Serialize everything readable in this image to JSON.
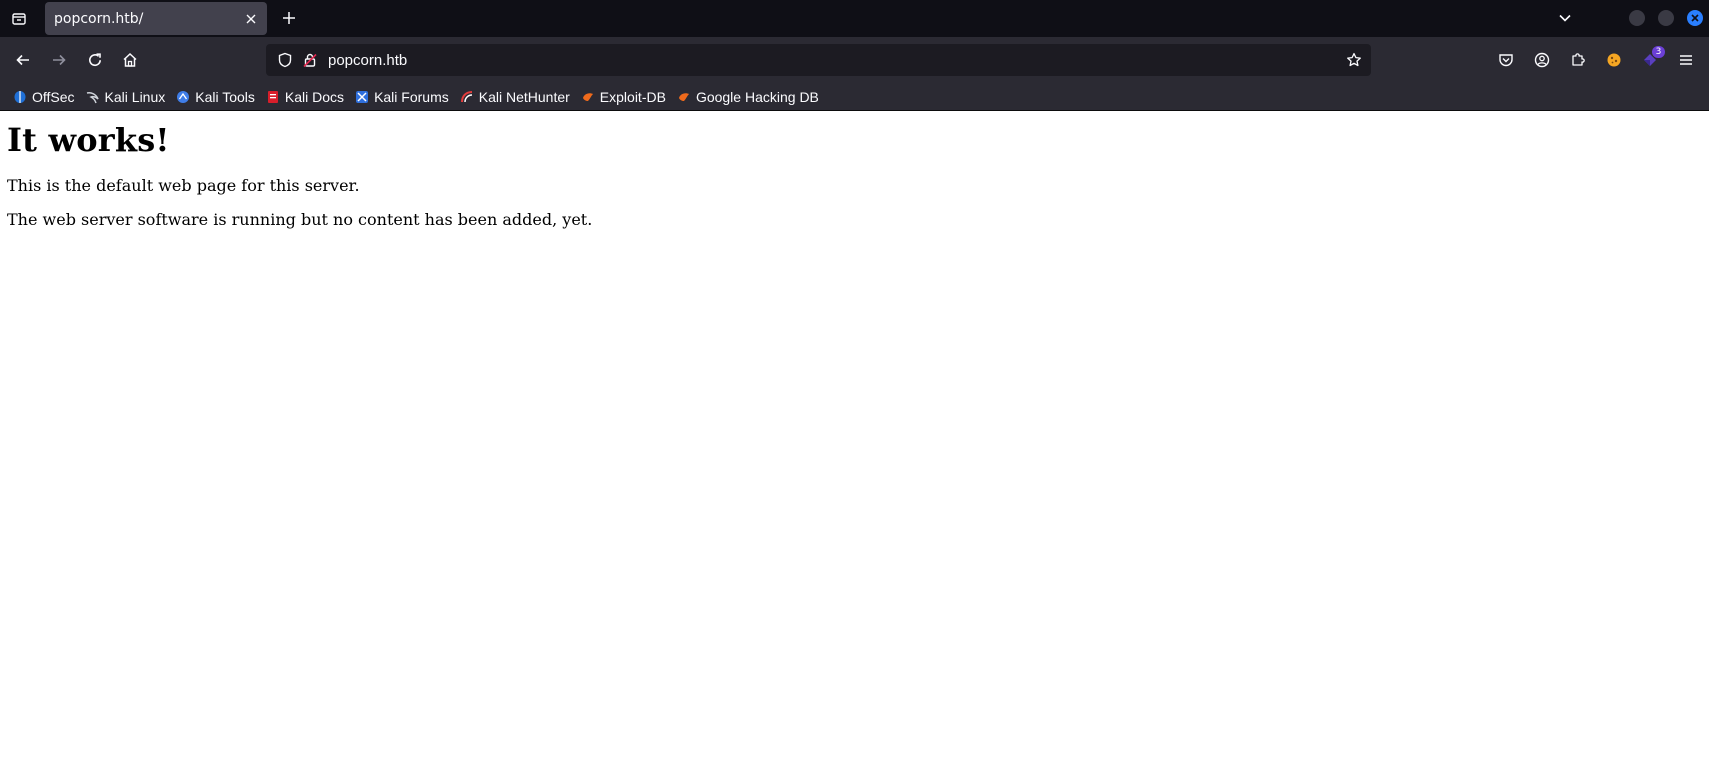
{
  "tabs": [
    {
      "title": "popcorn.htb/",
      "active": true
    }
  ],
  "navigation": {
    "url": "popcorn.htb",
    "extensions_badge": "3"
  },
  "bookmarks": [
    {
      "label": "OffSec",
      "icon": "offsec-icon"
    },
    {
      "label": "Kali Linux",
      "icon": "kali-dragon-icon"
    },
    {
      "label": "Kali Tools",
      "icon": "kali-tools-icon"
    },
    {
      "label": "Kali Docs",
      "icon": "kali-docs-icon"
    },
    {
      "label": "Kali Forums",
      "icon": "kali-forums-icon"
    },
    {
      "label": "Kali NetHunter",
      "icon": "nethunter-icon"
    },
    {
      "label": "Exploit-DB",
      "icon": "exploit-db-icon"
    },
    {
      "label": "Google Hacking DB",
      "icon": "ghdb-icon"
    }
  ],
  "page": {
    "heading": "It works!",
    "paragraphs": [
      "This is the default web page for this server.",
      "The web server software is running but no content has been added, yet."
    ]
  },
  "colors": {
    "tabstrip_bg": "#0f0f16",
    "toolbar_bg": "#2b2a33",
    "urlbar_bg": "#1c1b22",
    "accent_close": "#2a7fff"
  }
}
